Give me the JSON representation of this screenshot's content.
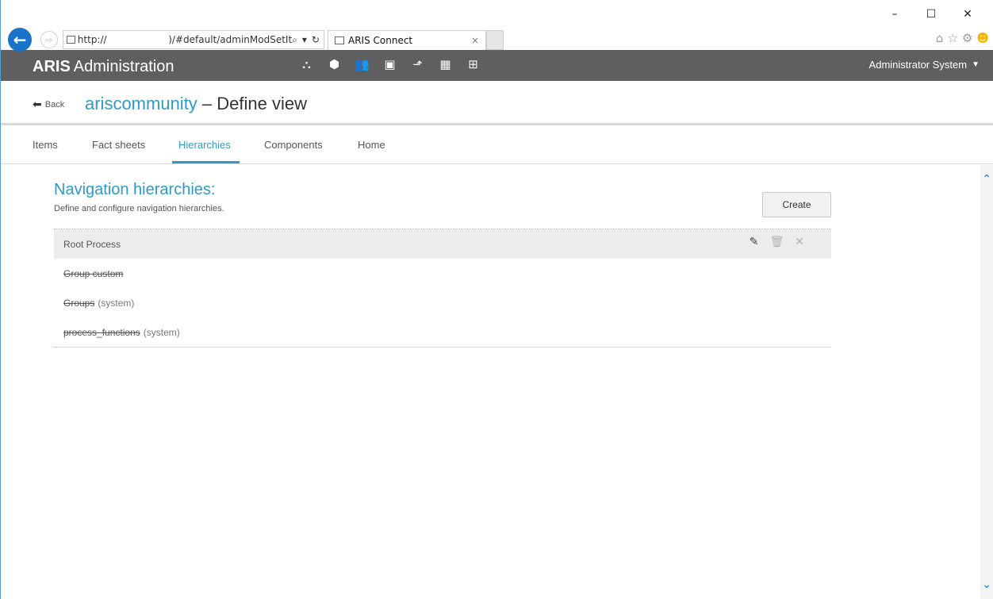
{
  "browser": {
    "url_start": "http://",
    "url_end": ")/#default/adminModSetIt",
    "search_icon": "search-icon",
    "refresh_icon": "refresh-icon",
    "tab_title": "ARIS Connect",
    "tab_close": "×",
    "window_controls": [
      "–",
      "☐",
      "✕"
    ]
  },
  "header": {
    "brand_bold": "ARIS",
    "brand_rest": "Administration",
    "icons": [
      "sitemap-icon",
      "package-icon",
      "users-icon",
      "documents-icon",
      "publish-icon",
      "apps-icon",
      "screen-icon"
    ],
    "user": "Administrator System"
  },
  "title_bar": {
    "back_label": "Back",
    "environment": "ariscommunity",
    "title_rest": " – Define view"
  },
  "tabs": [
    "Items",
    "Fact sheets",
    "Hierarchies",
    "Components",
    "Home"
  ],
  "active_tab": "Hierarchies",
  "section": {
    "title": "Navigation hierarchies:",
    "description": "Define and configure navigation hierarchies.",
    "create_label": "Create"
  },
  "hierarchies": [
    {
      "name": "Root Process",
      "suffix": "",
      "struck": false,
      "selected": true
    },
    {
      "name": "Group custom",
      "suffix": "",
      "struck": true,
      "selected": false
    },
    {
      "name": "Groups",
      "suffix": "(system)",
      "struck": true,
      "selected": false
    },
    {
      "name": "process_functions",
      "suffix": "(system)",
      "struck": true,
      "selected": false
    }
  ],
  "colors": {
    "accent": "#2e9bc6",
    "header_bg": "#5f5f5f",
    "browser_blue": "#1a73c8"
  }
}
